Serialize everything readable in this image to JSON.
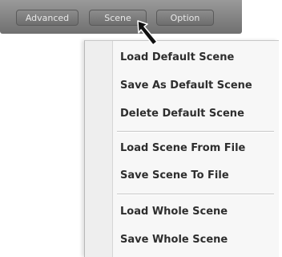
{
  "toolbar": {
    "tabs": [
      {
        "label": "Advanced"
      },
      {
        "label": "Scene"
      },
      {
        "label": "Option"
      }
    ]
  },
  "menu": {
    "items": [
      {
        "label": "Load Default Scene"
      },
      {
        "label": "Save As Default Scene"
      },
      {
        "label": "Delete Default Scene"
      },
      {
        "label": "Load Scene From File"
      },
      {
        "label": "Save Scene To File"
      },
      {
        "label": "Load Whole Scene"
      },
      {
        "label": "Save Whole Scene"
      }
    ]
  },
  "icons": {
    "cursor": "mouse-pointer-arrow-icon"
  }
}
